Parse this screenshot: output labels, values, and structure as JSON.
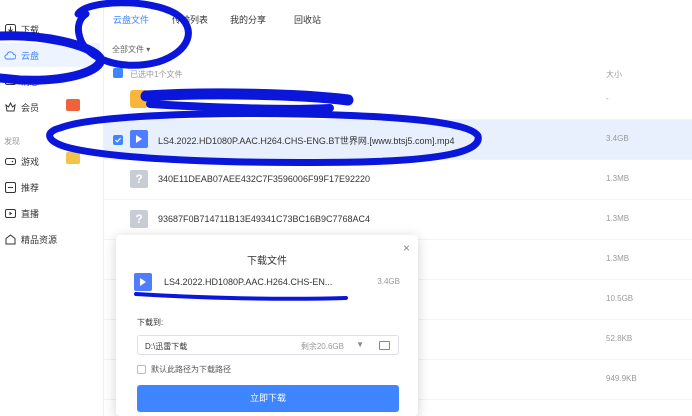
{
  "sidebar": {
    "items": [
      {
        "label": "下载",
        "icon": "download-icon"
      },
      {
        "label": "云盘",
        "icon": "cloud-icon"
      },
      {
        "label": "消息",
        "icon": "message-icon"
      },
      {
        "label": "会员",
        "icon": "vip-icon"
      }
    ],
    "section_label": "发现",
    "discover": [
      {
        "label": "游戏",
        "icon": "gamepad-icon"
      },
      {
        "label": "推荐",
        "icon": "recommend-icon"
      },
      {
        "label": "直播",
        "icon": "live-icon"
      },
      {
        "label": "精品资源",
        "icon": "resource-icon"
      }
    ]
  },
  "tabs": [
    "云盘文件",
    "传输列表",
    "我的分享",
    "回收站"
  ],
  "active_tab": "云盘文件",
  "filter_label": "全部文件 ▾",
  "list": {
    "selected_count": "已选中1个文件",
    "size_header": "大小",
    "rows": [
      {
        "name": "",
        "size": "-",
        "type": "folder"
      },
      {
        "name": "LS4.2022.HD1080P.AAC.H264.CHS-ENG.BT世界网.[www.btsj5.com].mp4",
        "size": "3.4GB",
        "type": "video"
      },
      {
        "name": "340E11DEAB07AEE432C7F3596006F99F17E92220",
        "size": "1.3MB",
        "type": "unknown"
      },
      {
        "name": "93687F0B714711B13E49341C73BC16B9C7768AC4",
        "size": "1.3MB",
        "type": "unknown"
      },
      {
        "name": "",
        "size": "1.3MB",
        "type": "unknown"
      },
      {
        "name": "",
        "size": "10.5GB",
        "type": "unknown"
      },
      {
        "name": "",
        "size": "52.8KB",
        "type": "unknown"
      },
      {
        "name": "",
        "size": "949.9KB",
        "type": "unknown"
      }
    ]
  },
  "dialog": {
    "title": "下载文件",
    "close": "×",
    "file_name": "LS4.2022.HD1080P.AAC.H264.CHS-EN...",
    "file_size": "3.4GB",
    "save_to_label": "下载到:",
    "path": "D:\\迅雷下载",
    "free_space": "剩余20.6GB",
    "default_path_option": "默认此路径为下载路径",
    "download_button": "立即下载"
  },
  "colors": {
    "accent": "#3f85ff",
    "scribble": "#0a16d9",
    "selected_row": "#e8f0fe"
  }
}
